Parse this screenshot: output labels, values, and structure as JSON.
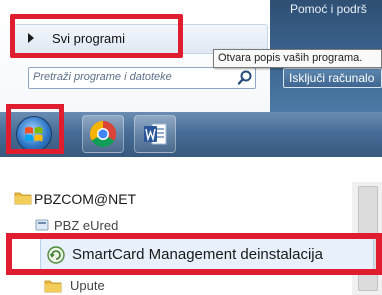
{
  "start_menu": {
    "all_programs_label": "Svi programi",
    "search_placeholder": "Pretraži programe i datoteke",
    "tooltip": "Otvara popis vaših programa.",
    "shutdown_label": "Isključi računalo",
    "right_panel_top_text": "Pomoć i podrš"
  },
  "taskbar": {
    "pinned": [
      "start-button",
      "chrome",
      "word"
    ]
  },
  "program_list": {
    "folder": "PBZCOM@NET",
    "items": [
      "PBZ eUred",
      "SmartCard Management deinstalacija",
      "Upute"
    ]
  },
  "annotations": {
    "highlight_color": "#e01c2f"
  },
  "colors": {
    "taskbar": "#476d97",
    "menu_right_panel": "#3d6690",
    "selection": "#e8f1fb"
  }
}
